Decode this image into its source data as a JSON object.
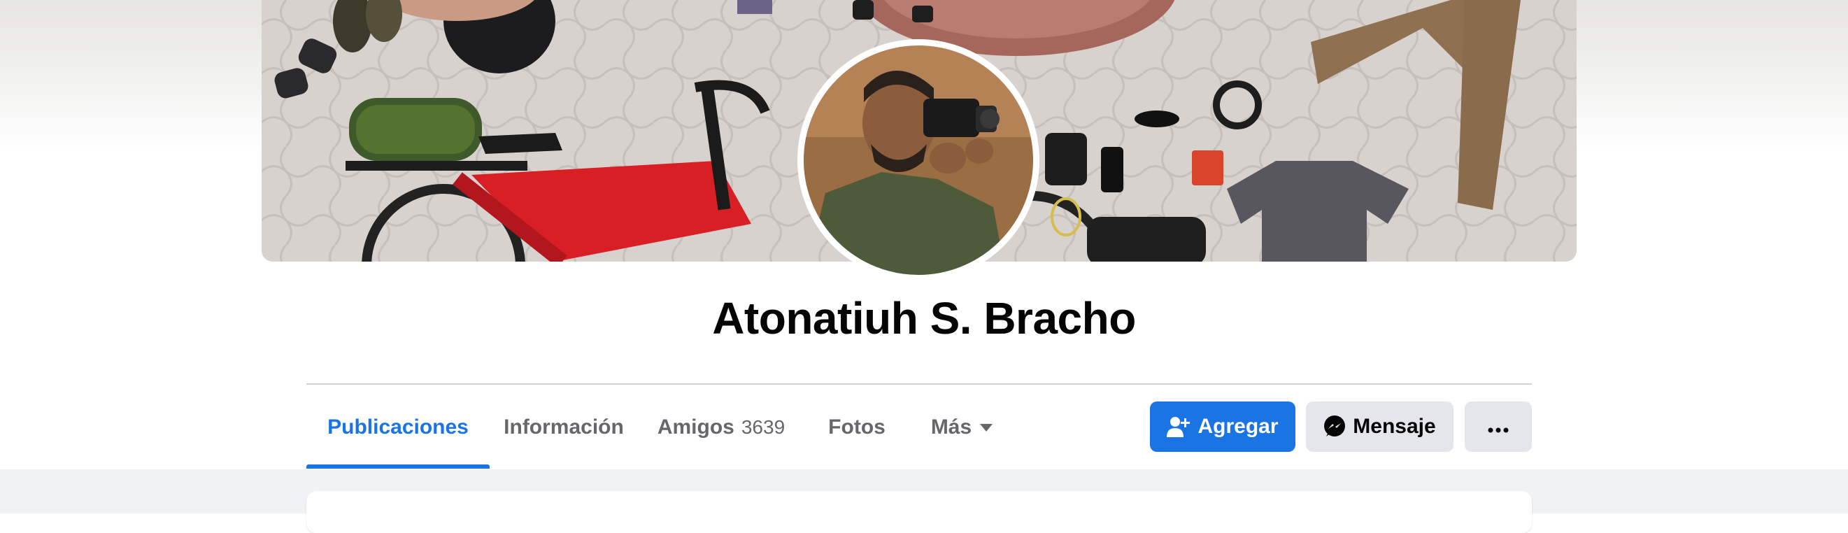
{
  "profile": {
    "name": "Atonatiuh S. Bracho"
  },
  "tabs": [
    {
      "label": "Publicaciones",
      "count": "",
      "active": true
    },
    {
      "label": "Información",
      "count": ""
    },
    {
      "label": "Amigos",
      "count": "3639"
    },
    {
      "label": "Fotos",
      "count": ""
    },
    {
      "label": "Más",
      "count": ""
    }
  ],
  "actions": {
    "add_label": "Agregar",
    "message_label": "Mensaje",
    "more_label": "···"
  },
  "icons": {
    "add": "add-friend-icon",
    "message": "messenger-icon",
    "more": "more-dots-icon",
    "tab_more": "caret-down-icon"
  },
  "colors": {
    "accent": "#1b74e4",
    "text": "#050505",
    "muted": "#65676b",
    "button_gray": "#e4e6eb",
    "background": "#f0f2f5"
  }
}
